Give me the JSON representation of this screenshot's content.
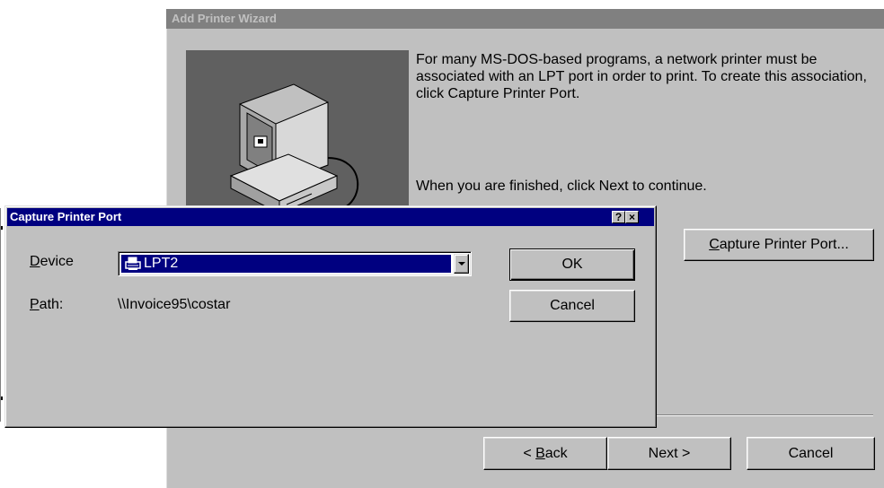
{
  "wizard": {
    "title": "Add Printer Wizard",
    "paragraph1": "For many MS-DOS-based programs, a network printer must be associated with an LPT port in order to print. To create this association, click Capture Printer Port.",
    "paragraph2": "When you are finished, click Next to continue.",
    "capture_button": {
      "mnemonic": "C",
      "rest": "apture Printer Port..."
    },
    "back_button": {
      "prefix": "< ",
      "mnemonic": "B",
      "rest": "ack"
    },
    "next_button": "Next >",
    "cancel_button": "Cancel"
  },
  "dialog": {
    "title": "Capture Printer Port",
    "help_glyph": "?",
    "close_glyph": "×",
    "device_label": {
      "mnemonic": "D",
      "rest": "evice"
    },
    "device_value": "LPT2",
    "path_label": {
      "mnemonic": "P",
      "rest": "ath:"
    },
    "path_value": "\\\\Invoice95\\costar",
    "ok_button": "OK",
    "cancel_button": "Cancel"
  },
  "colors": {
    "face": "#c0c0c0",
    "active_title": "#000080",
    "inactive_title": "#808080",
    "wizard_image_bg": "#606060"
  },
  "icons": [
    "computer-illustration",
    "printer-icon",
    "dropdown-arrow-icon",
    "help-icon",
    "close-icon"
  ]
}
